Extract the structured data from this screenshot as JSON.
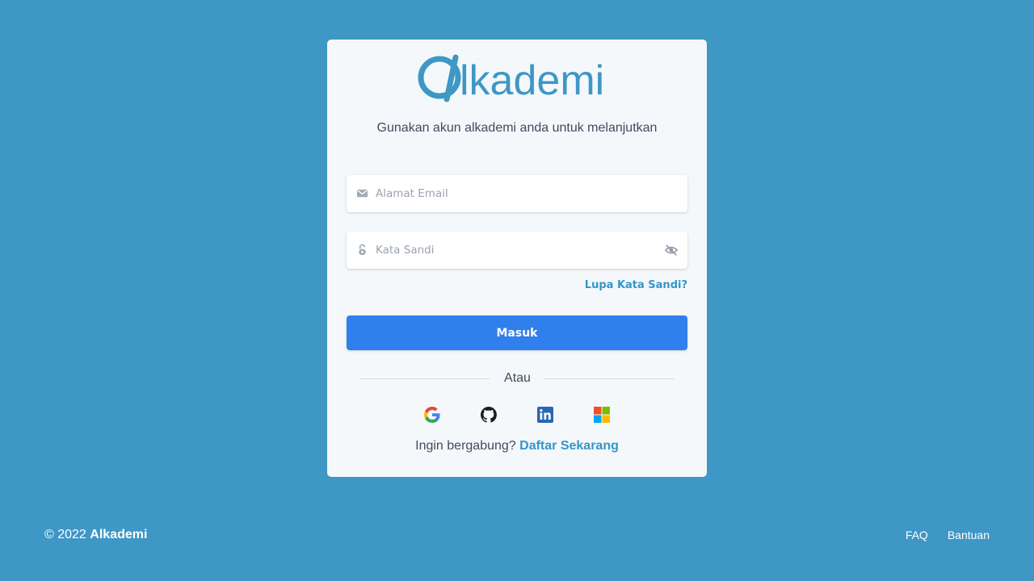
{
  "brand": {
    "name": "lkademi",
    "accent": "#3e97c5"
  },
  "login": {
    "subtitle": "Gunakan akun alkademi anda untuk melanjutkan",
    "email_placeholder": "Alamat Email",
    "password_placeholder": "Kata Sandi",
    "forgot_label": "Lupa Kata Sandi?",
    "submit_label": "Masuk",
    "divider_label": "Atau",
    "signup_prompt": "Ingin bergabung?",
    "signup_link": "Daftar Sekarang"
  },
  "social": [
    "google-icon",
    "github-icon",
    "linkedin-icon",
    "microsoft-icon"
  ],
  "footer": {
    "copyright": "© 2022",
    "brand": "Alkademi",
    "links": [
      "FAQ",
      "Bantuan"
    ]
  },
  "colors": {
    "background": "#3e97c5",
    "primary_button": "#2f7fec",
    "link": "#3496c9"
  }
}
